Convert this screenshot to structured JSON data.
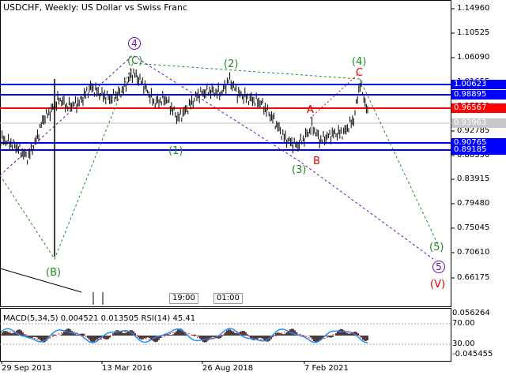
{
  "chart_title": "USDCHF, Weekly:  US Dollar vs Swiss Franc",
  "price_axis": [
    "1.14960",
    "1.10525",
    "1.06090",
    "1.01655",
    "0.97220",
    "0.92785",
    "0.88350",
    "0.83915",
    "0.79480",
    "0.75045",
    "0.70610",
    "0.66175"
  ],
  "level_boxes": [
    {
      "label": "1.00623",
      "bg": "#0000ff",
      "fg": "#ffffff"
    },
    {
      "label": "0.98895",
      "bg": "#0000ff",
      "fg": "#ffffff"
    },
    {
      "label": "0.96567",
      "bg": "#ff0000",
      "fg": "#ffffff"
    },
    {
      "label": "0.93963",
      "bg": "#c8c8c8",
      "fg": "#ffffff"
    },
    {
      "label": "0.90765",
      "bg": "#0000ff",
      "fg": "#ffffff"
    },
    {
      "label": "0.89185",
      "bg": "#0000ff",
      "fg": "#ffffff"
    }
  ],
  "time_axis": [
    "29 Sep 2013",
    "13 Mar 2016",
    "26 Aug 2018",
    "7 Feb 2021"
  ],
  "scroll_labels": [
    "19:00",
    "01:00"
  ],
  "wave_labels": {
    "w4_circled": "4",
    "wC": "(C)",
    "w2": "(2)",
    "w4": "(4)",
    "wA": "A",
    "wC2": "C",
    "w1": "(1)",
    "w3": "(3)",
    "wB": "B",
    "wB2": "(B)",
    "w5": "(5)",
    "w5_circled": "5",
    "wV": "(V)"
  },
  "indicator_title": "MACD(5,34,5) 0.004521 0.013505 RSI(14) 45.41",
  "indicator_axis": [
    "0.056264",
    "70.00",
    "30.00",
    "-0.045455"
  ],
  "colors": {
    "blue_level": "#0000ff",
    "red_level": "#ff0000",
    "green_labels": "#228b22",
    "purple_labels": "#6a0dad",
    "red_labels": "#dd0000"
  }
}
